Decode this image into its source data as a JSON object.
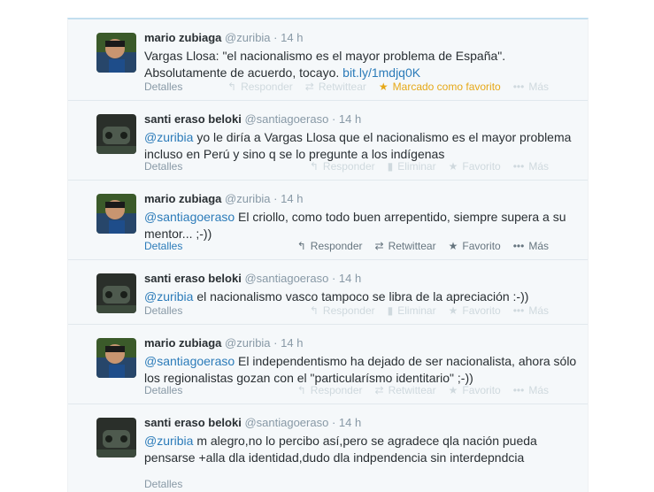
{
  "timeline": {
    "tweets": [
      {
        "fullname": "mario zubiaga",
        "username": "@zuribia",
        "time": "14 h",
        "text_prefix": "",
        "lines": [
          "Vargas Llosa: \"el nacionalismo es el mayor problema de España\".",
          "Absolutamente de acuerdo, tocayo. "
        ],
        "link": "bit.ly/1mdjq0K",
        "details": "Detalles",
        "actions": [
          "Responder",
          "Retwittear",
          "Marcado como favorito",
          "Más"
        ]
      },
      {
        "fullname": "santi eraso beloki",
        "username": "@santiagoeraso",
        "time": "14 h",
        "mention": "@zuribia",
        "lines": [
          " yo le diría a Vargas Llosa que el nacionalismo es el mayor problema",
          "incluso en Perú y sino q se lo pregunte a los indígenas"
        ],
        "details": "Detalles",
        "actions": [
          "Responder",
          "Eliminar",
          "Favorito",
          "Más"
        ]
      },
      {
        "fullname": "mario zubiaga",
        "username": "@zuribia",
        "time": "14 h",
        "mention": "@santiagoeraso",
        "lines": [
          " El criollo, como todo buen arrepentido, siempre supera a su",
          "mentor... ;-))"
        ],
        "details": "Detalles",
        "actions": [
          "Responder",
          "Retwittear",
          "Favorito",
          "Más"
        ]
      },
      {
        "fullname": "santi eraso beloki",
        "username": "@santiagoeraso",
        "time": "14 h",
        "mention": "@zuribia",
        "lines": [
          " el nacionalismo vasco tampoco se libra de la apreciación :-))"
        ],
        "details": "Detalles",
        "actions": [
          "Responder",
          "Eliminar",
          "Favorito",
          "Más"
        ]
      },
      {
        "fullname": "mario zubiaga",
        "username": "@zuribia",
        "time": "14 h",
        "mention": "@santiagoeraso",
        "lines": [
          " El independentismo ha dejado de ser nacionalista, ahora sólo",
          "los regionalistas gozan con el \"particularísmo identitario\" ;-))"
        ],
        "details": "Detalles",
        "actions": [
          "Responder",
          "Retwittear",
          "Favorito",
          "Más"
        ]
      },
      {
        "fullname": "santi eraso beloki",
        "username": "@santiagoeraso",
        "time": "14 h",
        "mention": "@zuribia",
        "lines": [
          " m alegro,no lo percibo así,pero se agradece qla nación pueda",
          "pensarse +alla dla identidad,dudo dla indpendencia sin interdepndcia"
        ],
        "details": "Detalles",
        "actions": []
      }
    ]
  },
  "colors": {
    "link": "#2b7bb9",
    "favorite": "#e6a817",
    "muted": "#8899a6"
  }
}
